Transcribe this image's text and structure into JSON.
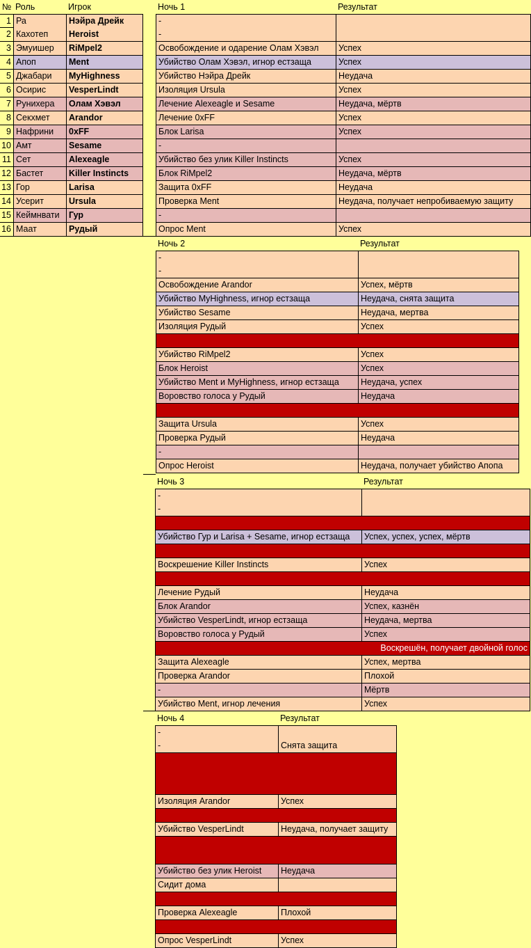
{
  "roster": {
    "headers": {
      "num": "№",
      "role": "Роль",
      "player": "Игрок"
    },
    "rows": [
      {
        "num": "1",
        "role": "Ра",
        "player": "Нэйра Дрейк",
        "color": "p"
      },
      {
        "num": "2",
        "role": "Кахотеп",
        "player": "Heroist",
        "color": "p"
      },
      {
        "num": "3",
        "role": "Эмуишер",
        "player": "RiMpel2",
        "color": "p"
      },
      {
        "num": "4",
        "role": "Апоп",
        "player": "Ment",
        "color": "l"
      },
      {
        "num": "5",
        "role": "Джабари",
        "player": "MyHighness",
        "color": "p"
      },
      {
        "num": "6",
        "role": "Осирис",
        "player": "VesperLindt",
        "color": "p"
      },
      {
        "num": "7",
        "role": "Рунихера",
        "player": "Олам Хэвэл",
        "color": "k"
      },
      {
        "num": "8",
        "role": "Секхмет",
        "player": "Arandor",
        "color": "p"
      },
      {
        "num": "9",
        "role": "Нафрини",
        "player": "0xFF",
        "color": "k"
      },
      {
        "num": "10",
        "role": "Амт",
        "player": "Sesame",
        "color": "k"
      },
      {
        "num": "11",
        "role": "Сет",
        "player": "Alexeagle",
        "color": "k"
      },
      {
        "num": "12",
        "role": "Бастет",
        "player": "Killer Instincts",
        "color": "k"
      },
      {
        "num": "13",
        "role": "Гор",
        "player": "Larisa",
        "color": "p"
      },
      {
        "num": "14",
        "role": "Усерит",
        "player": "Ursula",
        "color": "p"
      },
      {
        "num": "15",
        "role": "Кеймнвати",
        "player": "Гур",
        "color": "k"
      },
      {
        "num": "16",
        "role": "Маат",
        "player": "Рудый",
        "color": "p"
      }
    ]
  },
  "nights": [
    {
      "title": "Ночь 1",
      "result_header": "Результат",
      "rows": [
        {
          "action": "-",
          "result": "",
          "color": "p"
        },
        {
          "action": "-",
          "result": "",
          "color": "p"
        },
        {
          "action": "Освобождение и одарение Олам Хэвэл",
          "result": "Успех",
          "color": "p"
        },
        {
          "action": "Убийство Олам Хэвэл, игнор естзаща",
          "result": "Успех",
          "color": "l"
        },
        {
          "action": "Убийство Нэйра Дрейк",
          "result": "Неудача",
          "color": "p"
        },
        {
          "action": "Изоляция Ursula",
          "result": "Успех",
          "color": "p"
        },
        {
          "action": "Лечение Alexeagle и Sesame",
          "result": "Неудача, мёртв",
          "color": "k"
        },
        {
          "action": "Лечение 0xFF",
          "result": "Успех",
          "color": "p"
        },
        {
          "action": "Блок Larisa",
          "result": "Успех",
          "color": "k"
        },
        {
          "action": "-",
          "result": "",
          "color": "k"
        },
        {
          "action": "Убийство без улик Killer Instincts",
          "result": "Успех",
          "color": "k"
        },
        {
          "action": "Блок RiMpel2",
          "result": "Неудача, мёртв",
          "color": "k"
        },
        {
          "action": "Защита 0xFF",
          "result": "Неудача",
          "color": "p"
        },
        {
          "action": "Проверка Ment",
          "result": "Неудача, получает непробиваемую защиту",
          "color": "p"
        },
        {
          "action": "-",
          "result": "",
          "color": "k"
        },
        {
          "action": "Опрос Ment",
          "result": "Успех",
          "color": "p"
        }
      ]
    },
    {
      "title": "Ночь 2",
      "result_header": "Результат",
      "rows": [
        {
          "action": "-",
          "result": "",
          "color": "p"
        },
        {
          "action": "-",
          "result": "",
          "color": "p"
        },
        {
          "action": "Освобождение Arandor",
          "result": "Успех, мёртв",
          "color": "p"
        },
        {
          "action": "Убийство MyHighness, игнор естзаща",
          "result": "Неудача, снята защита",
          "color": "l"
        },
        {
          "action": "Убийство Sesame",
          "result": "Неудача, мертва",
          "color": "p"
        },
        {
          "action": "Изоляция Рудый",
          "result": "Успех",
          "color": "p"
        },
        {
          "action": "",
          "result": "",
          "color": "r"
        },
        {
          "action": "Убийство RiMpel2",
          "result": "Успех",
          "color": "p"
        },
        {
          "action": "Блок Heroist",
          "result": "Успех",
          "color": "k"
        },
        {
          "action": "Убийство Ment и MyHighness, игнор естзаща",
          "result": "Неудача, успех",
          "color": "k"
        },
        {
          "action": "Воровство голоса у Рудый",
          "result": "Неудача",
          "color": "k"
        },
        {
          "action": "",
          "result": "",
          "color": "r"
        },
        {
          "action": "Защита Ursula",
          "result": "Успех",
          "color": "p"
        },
        {
          "action": "Проверка Рудый",
          "result": "Неудача",
          "color": "p"
        },
        {
          "action": "-",
          "result": "",
          "color": "k"
        },
        {
          "action": "Опрос Heroist",
          "result": "Неудача, получает убийство Апопа",
          "color": "p"
        }
      ]
    },
    {
      "title": "Ночь 3",
      "result_header": "Результат",
      "rows": [
        {
          "action": "-",
          "result": "",
          "color": "p"
        },
        {
          "action": "-",
          "result": "",
          "color": "p"
        },
        {
          "action": "",
          "result": "",
          "color": "r"
        },
        {
          "action": "Убийство Гур и Larisa + Sesame, игнор естзаща",
          "result": "Успех, успех, успех, мёртв",
          "color": "l"
        },
        {
          "action": "",
          "result": "",
          "color": "r"
        },
        {
          "action": "Воскрешение Killer Instincts",
          "result": "Успех",
          "color": "p"
        },
        {
          "action": "",
          "result": "",
          "color": "r"
        },
        {
          "action": "Лечение Рудый",
          "result": "Неудача",
          "color": "p"
        },
        {
          "action": "Блок Arandor",
          "result": "Успех, казнён",
          "color": "k"
        },
        {
          "action": "Убийство VesperLindt, игнор естзаща",
          "result": "Неудача, мертва",
          "color": "k"
        },
        {
          "action": "Воровство голоса у Рудый",
          "result": "Успех",
          "color": "k"
        },
        {
          "action": "",
          "result": "Воскрешён, получает двойной голос",
          "color": "r",
          "align": "right"
        },
        {
          "action": "Защита Alexeagle",
          "result": "Успех, мертва",
          "color": "p"
        },
        {
          "action": "Проверка Arandor",
          "result": "Плохой",
          "color": "p"
        },
        {
          "action": "-",
          "result": "Мёртв",
          "color": "k"
        },
        {
          "action": "Убийство Ment, игнор лечения",
          "result": "Успех",
          "color": "p"
        }
      ]
    },
    {
      "title": "Ночь 4",
      "result_header": "Результат",
      "rows": [
        {
          "action": "-",
          "result": "",
          "color": "p"
        },
        {
          "action": "-",
          "result": "Снята защита",
          "color": "p"
        },
        {
          "action": "",
          "result": "",
          "color": "r",
          "tall": 3
        },
        {
          "action": "Изоляция Arandor",
          "result": "Успех",
          "color": "p"
        },
        {
          "action": "",
          "result": "",
          "color": "r"
        },
        {
          "action": "Убийство VesperLindt",
          "result": "Неудача, получает защиту",
          "color": "p"
        },
        {
          "action": "",
          "result": "",
          "color": "r",
          "tall": 2
        },
        {
          "action": "Убийство без улик Heroist",
          "result": "Неудача",
          "color": "k"
        },
        {
          "action": "Сидит дома",
          "result": "",
          "color": "p"
        },
        {
          "action": "",
          "result": "",
          "color": "r"
        },
        {
          "action": "Проверка Alexeagle",
          "result": "Плохой",
          "color": "p"
        },
        {
          "action": "",
          "result": "",
          "color": "r"
        },
        {
          "action": "Опрос VesperLindt",
          "result": "Успех",
          "color": "p"
        }
      ]
    }
  ]
}
